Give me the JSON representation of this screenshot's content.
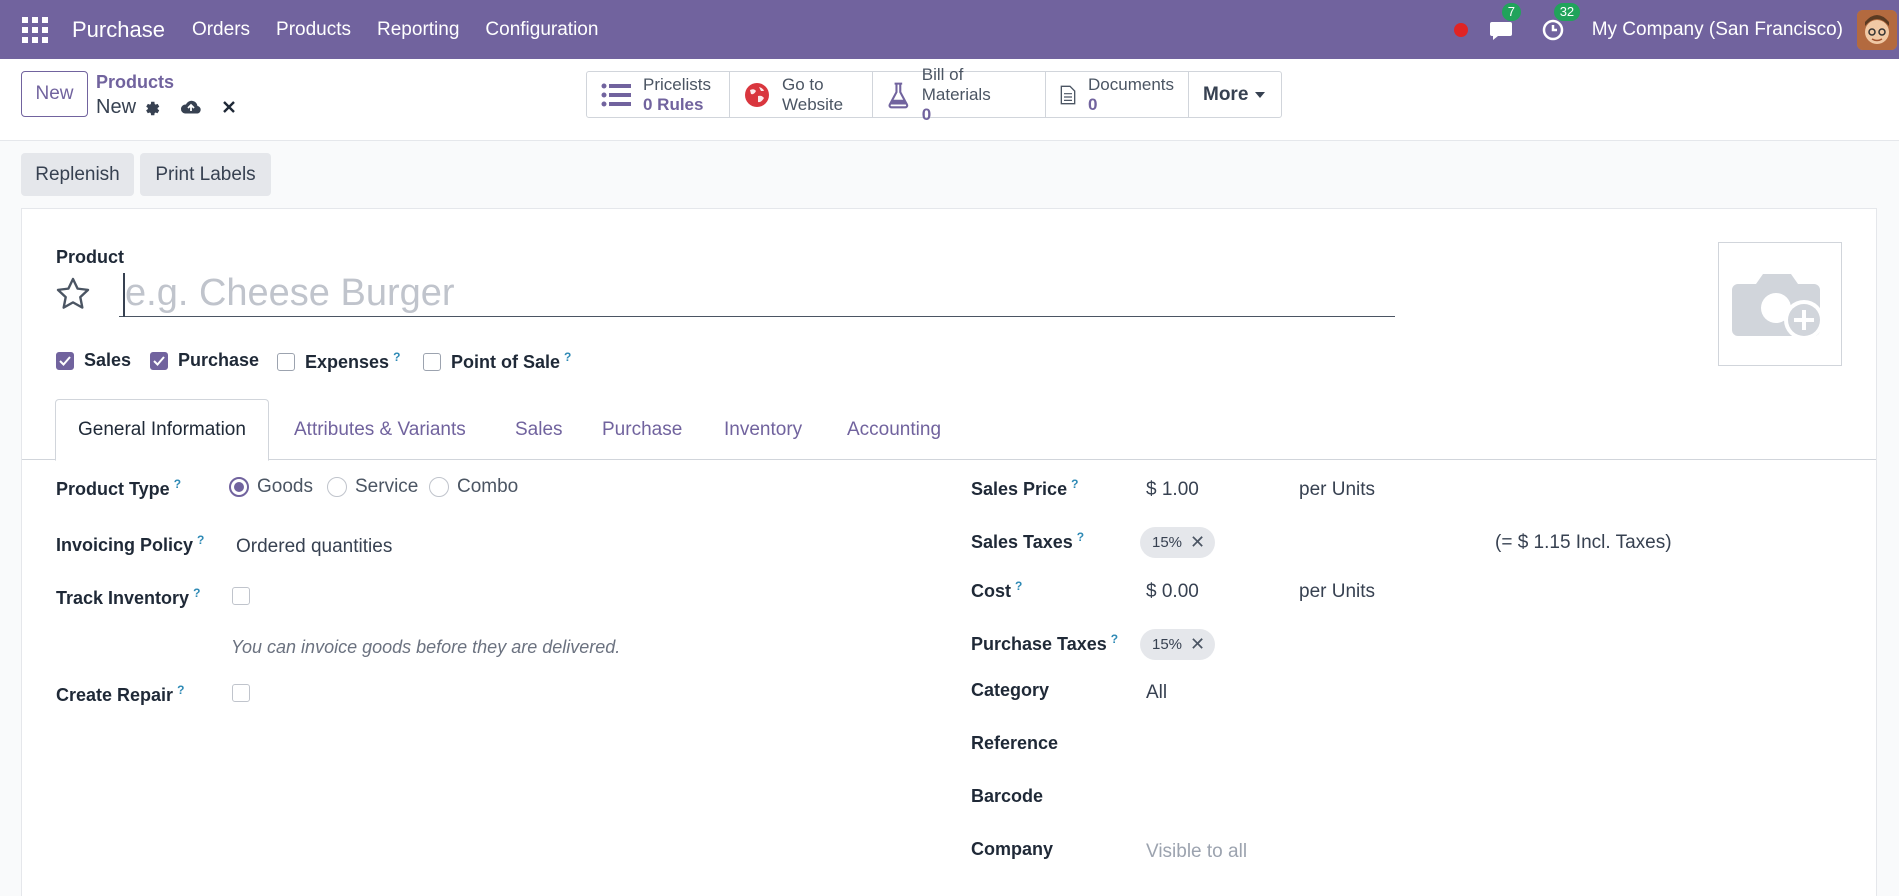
{
  "navbar": {
    "app_name": "Purchase",
    "menu": [
      "Orders",
      "Products",
      "Reporting",
      "Configuration"
    ],
    "messages_count": "7",
    "activities_count": "32",
    "company": "My Company (San Francisco)"
  },
  "control_panel": {
    "new_label": "New",
    "breadcrumb_parent": "Products",
    "breadcrumb_current": "New",
    "smart_buttons": {
      "pricelists": {
        "label": "Pricelists",
        "value": "0  Rules"
      },
      "website": {
        "label1": "Go to",
        "label2": "Website"
      },
      "bom": {
        "label": "Bill of Materials",
        "value": "0"
      },
      "documents": {
        "label": "Documents",
        "value": "0"
      },
      "more": "More"
    }
  },
  "actions": {
    "replenish": "Replenish",
    "print_labels": "Print Labels"
  },
  "form": {
    "product_label": "Product",
    "name_placeholder": "e.g. Cheese Burger",
    "checkboxes": {
      "sales": "Sales",
      "purchase": "Purchase",
      "expenses": "Expenses",
      "pos": "Point of Sale"
    },
    "tabs": [
      "General Information",
      "Attributes & Variants",
      "Sales",
      "Purchase",
      "Inventory",
      "Accounting"
    ],
    "left": {
      "product_type_label": "Product Type",
      "product_type_options": [
        "Goods",
        "Service",
        "Combo"
      ],
      "invoicing_policy_label": "Invoicing Policy",
      "invoicing_policy_value": "Ordered quantities",
      "track_inventory_label": "Track Inventory",
      "hint": "You can invoice goods before they are delivered.",
      "create_repair_label": "Create Repair"
    },
    "right": {
      "sales_price_label": "Sales Price",
      "sales_price_value": "$ 1.00",
      "sales_price_uom": "per  Units",
      "sales_taxes_label": "Sales Taxes",
      "sales_taxes_tag": "15%",
      "incl_taxes": "(= $ 1.15 Incl. Taxes)",
      "cost_label": "Cost",
      "cost_value": "$ 0.00",
      "cost_uom": "per Units",
      "purchase_taxes_label": "Purchase Taxes",
      "purchase_taxes_tag": "15%",
      "category_label": "Category",
      "category_value": "All",
      "reference_label": "Reference",
      "barcode_label": "Barcode",
      "company_label": "Company",
      "company_placeholder": "Visible to all"
    },
    "help_mark": "?"
  },
  "colors": {
    "brand": "#71639e",
    "badge": "#21a35b",
    "help": "#2f8ab5"
  }
}
